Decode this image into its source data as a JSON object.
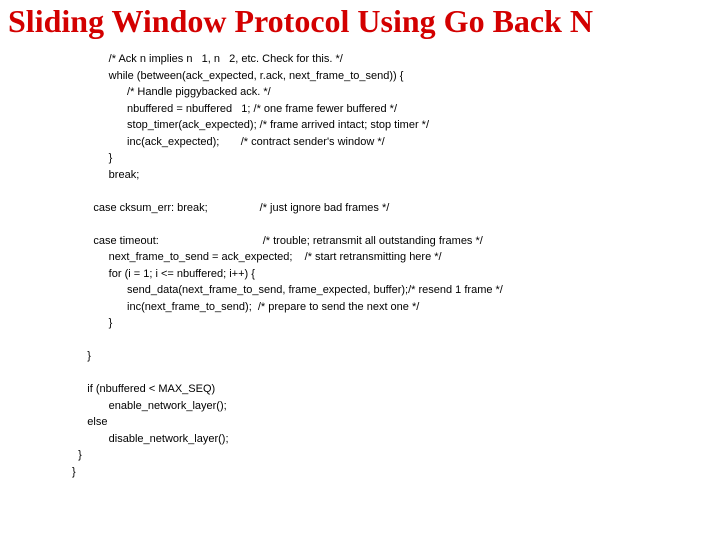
{
  "title": "Sliding Window Protocol Using Go Back N",
  "code_lines": [
    "            /* Ack n implies n   1, n   2, etc. Check for this. */",
    "            while (between(ack_expected, r.ack, next_frame_to_send)) {",
    "                  /* Handle piggybacked ack. */",
    "                  nbuffered = nbuffered   1; /* one frame fewer buffered */",
    "                  stop_timer(ack_expected); /* frame arrived intact; stop timer */",
    "                  inc(ack_expected);       /* contract sender's window */",
    "            }",
    "            break;",
    "",
    "       case cksum_err: break;                 /* just ignore bad frames */",
    "",
    "       case timeout:                                  /* trouble; retransmit all outstanding frames */",
    "            next_frame_to_send = ack_expected;    /* start retransmitting here */",
    "            for (i = 1; i <= nbuffered; i++) {",
    "                  send_data(next_frame_to_send, frame_expected, buffer);/* resend 1 frame */",
    "                  inc(next_frame_to_send);  /* prepare to send the next one */",
    "            }",
    "",
    "     }",
    "",
    "     if (nbuffered < MAX_SEQ)",
    "            enable_network_layer();",
    "     else",
    "            disable_network_layer();",
    "  }",
    "}"
  ]
}
